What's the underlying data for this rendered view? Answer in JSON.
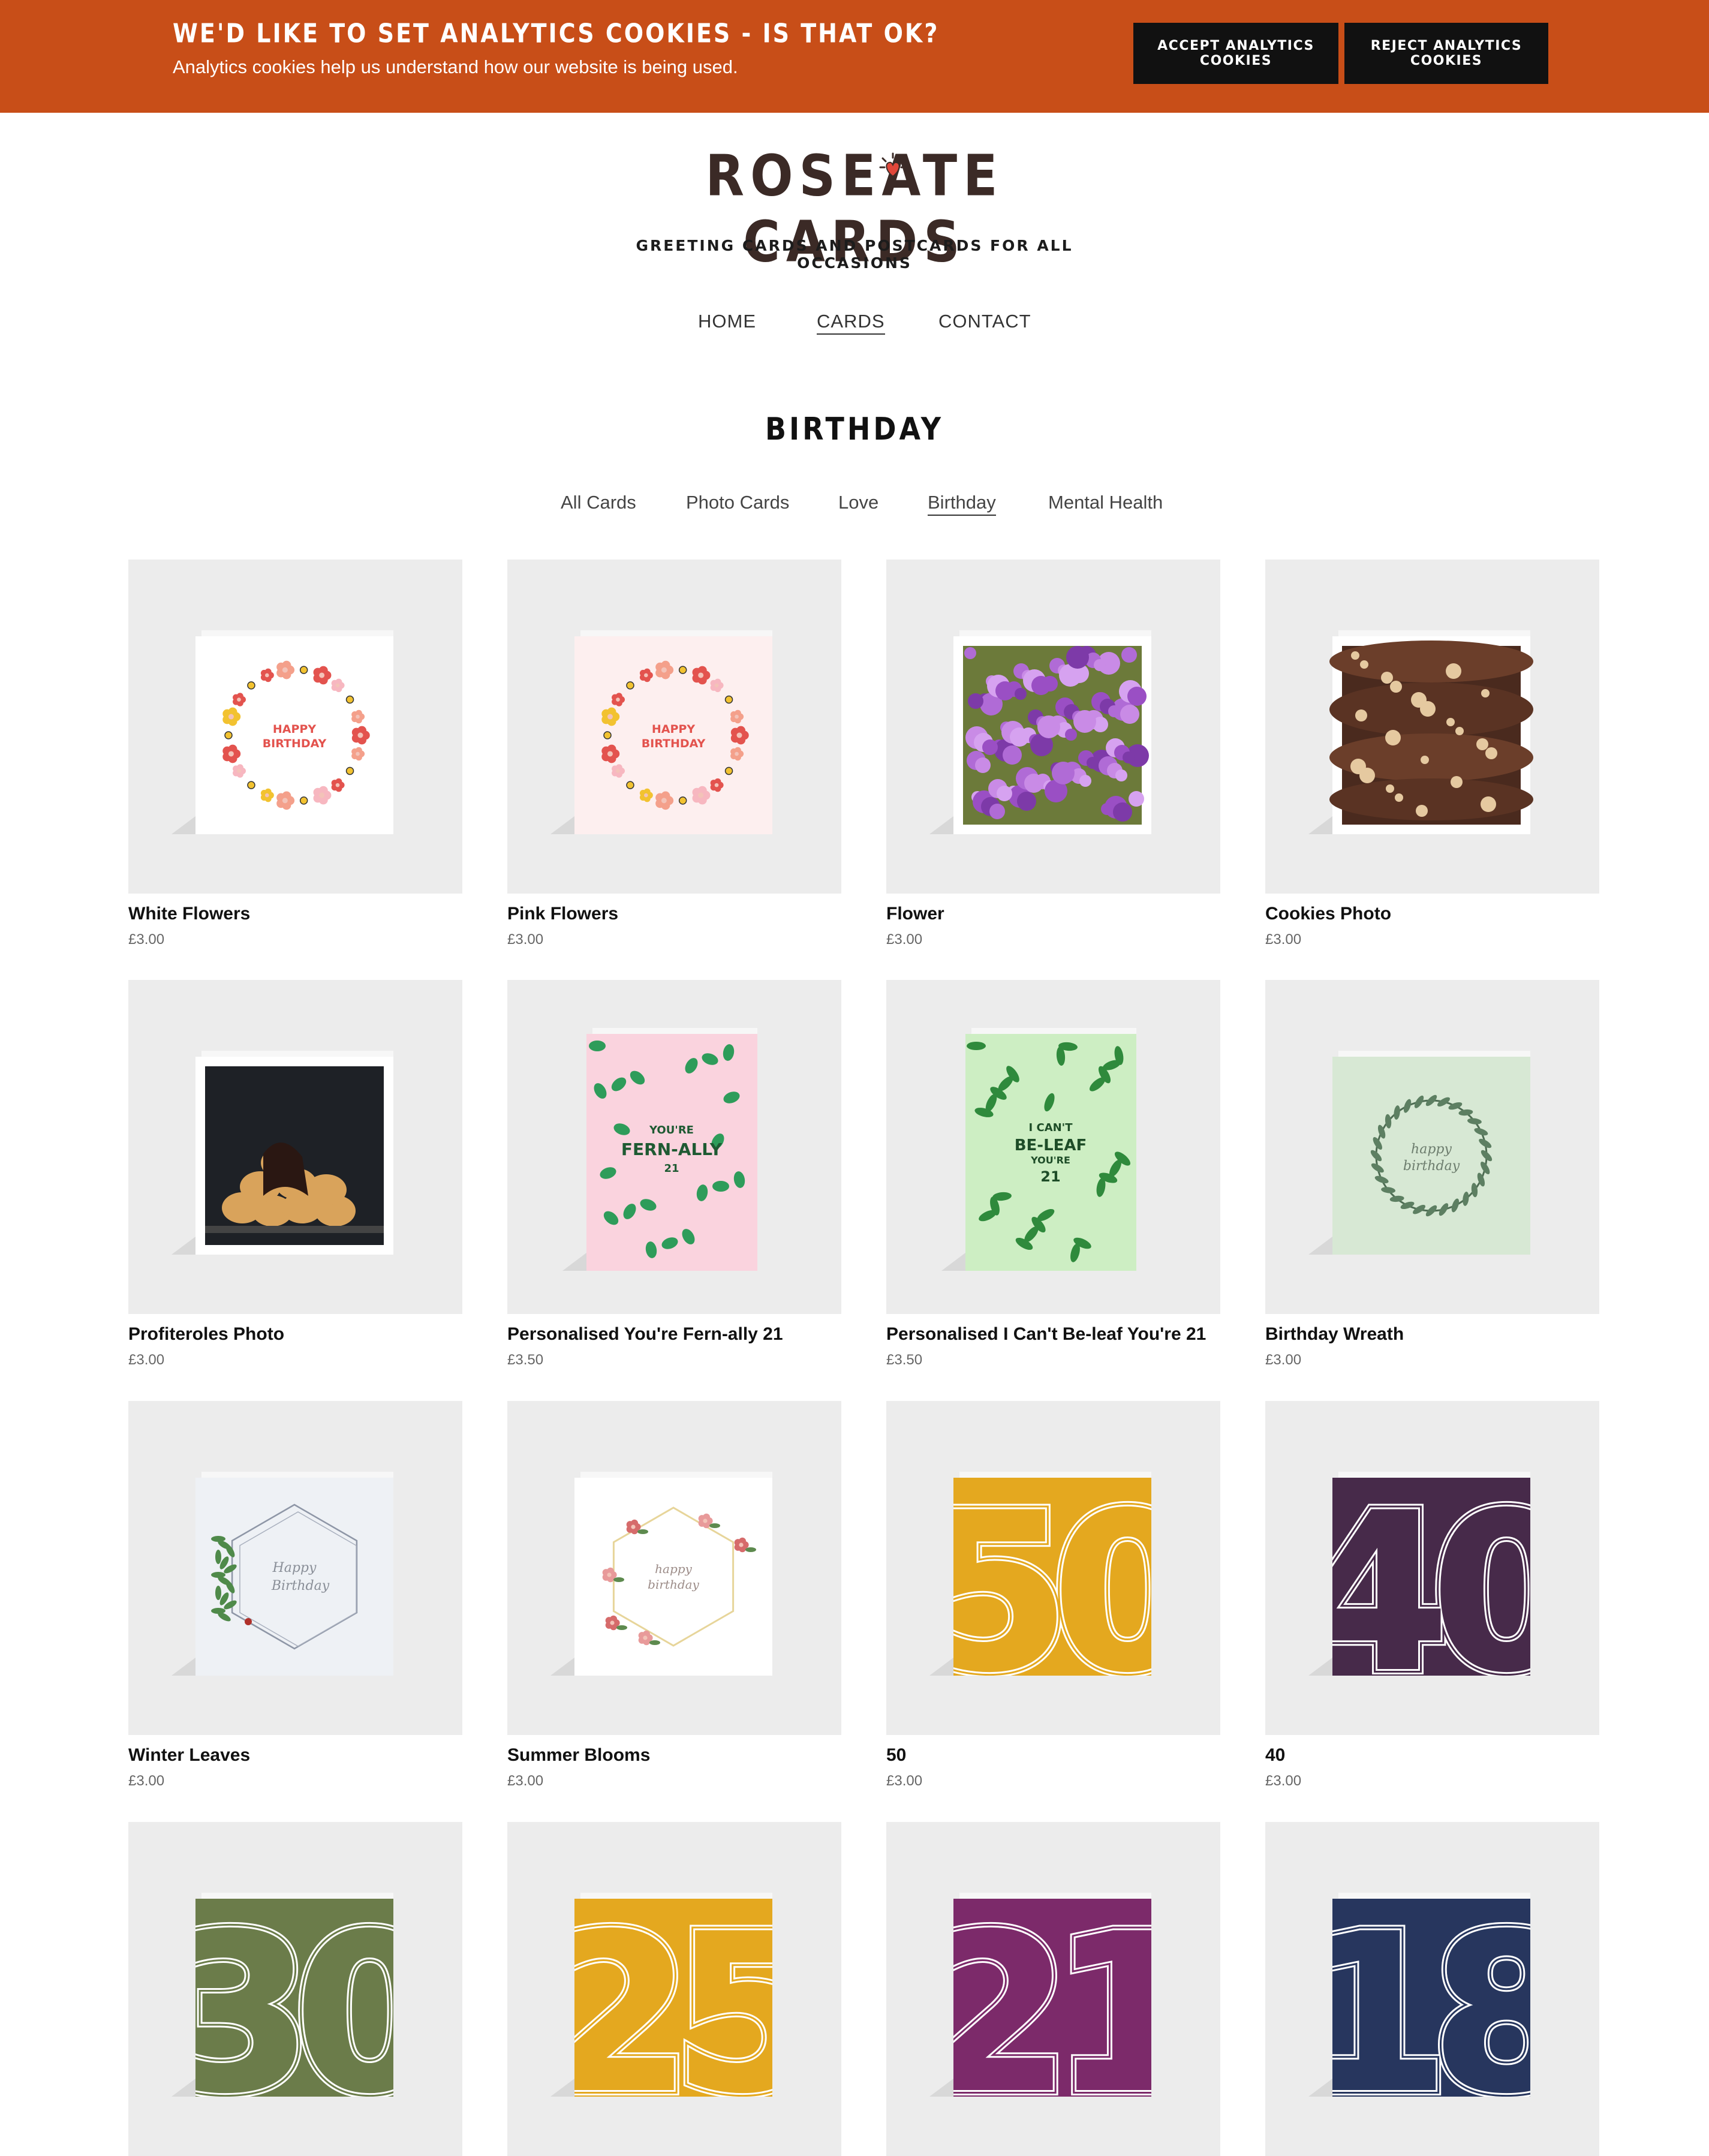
{
  "cookie_banner": {
    "title": "We'd like to set analytics cookies - is that ok?",
    "text": "Analytics cookies help us understand how our website is being used.",
    "accept_label": "Accept analytics cookies",
    "reject_label": "Reject analytics cookies",
    "bg_color": "#c84e18"
  },
  "logo": {
    "name": "Roseate Cards",
    "tagline": "Greeting cards and postcards for all occasions",
    "heart_color": "#e0473a"
  },
  "nav": {
    "home": "HOME",
    "cards": "CARDS",
    "contact": "CONTACT",
    "active": "CARDS"
  },
  "page": {
    "title": "Birthday"
  },
  "categories": {
    "all": "All Cards",
    "photo": "Photo Cards",
    "love": "Love",
    "birthday": "Birthday",
    "mental": "Mental Health",
    "active": "Birthday"
  },
  "products": [
    {
      "name": "White Flowers",
      "price": "£3.00",
      "art": "wreath-white"
    },
    {
      "name": "Pink Flowers",
      "price": "£3.00",
      "art": "wreath-pink"
    },
    {
      "name": "Flower",
      "price": "£3.00",
      "art": "photo-flower"
    },
    {
      "name": "Cookies Photo",
      "price": "£3.00",
      "art": "photo-cookies"
    },
    {
      "name": "Profiteroles Photo",
      "price": "£3.00",
      "art": "photo-profiteroles"
    },
    {
      "name": "Personalised You're Fern-ally 21",
      "price": "£3.50",
      "art": "fern"
    },
    {
      "name": "Personalised I Can't Be-leaf You're 21",
      "price": "£3.50",
      "art": "leaf"
    },
    {
      "name": "Birthday Wreath",
      "price": "£3.00",
      "art": "wreath-green"
    },
    {
      "name": "Winter Leaves",
      "price": "£3.00",
      "art": "hex-winter"
    },
    {
      "name": "Summer Blooms",
      "price": "£3.00",
      "art": "hex-summer"
    },
    {
      "name": "50",
      "price": "£3.00",
      "art": "number",
      "number": "50",
      "color": "#e4a81f"
    },
    {
      "name": "40",
      "price": "£3.00",
      "art": "number",
      "number": "40",
      "color": "#472a4a"
    },
    {
      "name": "",
      "price": "",
      "art": "number",
      "number": "30",
      "color": "#6b7c4a"
    },
    {
      "name": "",
      "price": "",
      "art": "number",
      "number": "25",
      "color": "#e4a81f"
    },
    {
      "name": "",
      "price": "",
      "art": "number",
      "number": "21",
      "color": "#7c2a6a"
    },
    {
      "name": "",
      "price": "",
      "art": "number",
      "number": "18",
      "color": "#27365e"
    }
  ],
  "card_texts": {
    "happy_birthday": "HAPPY BIRTHDAY",
    "fern_line1": "YOU'RE",
    "fern_line2": "FERN-ALLY",
    "fern_line3": "21",
    "leaf_line1": "I CAN'T",
    "leaf_line2": "BE-LEAF",
    "leaf_line3": "YOU'RE",
    "leaf_line4": "21",
    "script_happy": "happy",
    "script_birthday": "birthday",
    "script_Happy": "Happy",
    "script_Birthday": "Birthday"
  }
}
